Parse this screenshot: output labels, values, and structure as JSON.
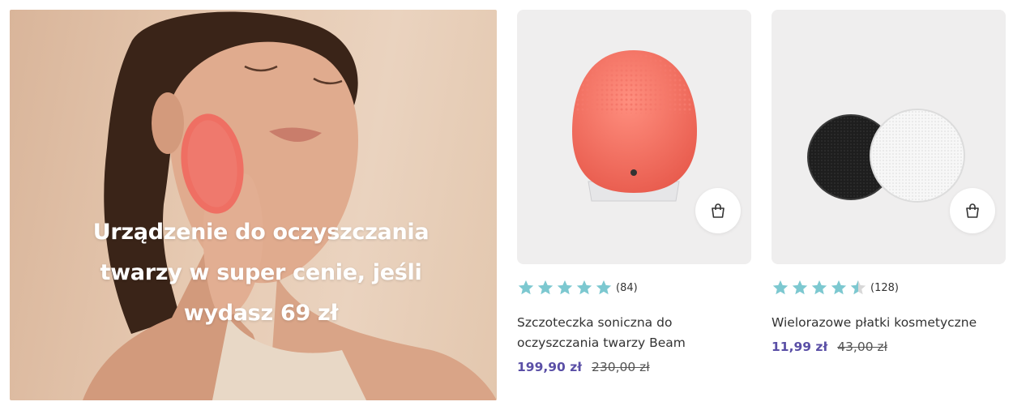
{
  "promo": {
    "headline": "Urządzenie do oczyszczania twarzy w super cenie, jeśli wydasz 69 zł",
    "image_icon": "woman-with-face-cleansing-device-photo"
  },
  "products": [
    {
      "name": "Szczoteczka soniczna do oczyszczania twarzy Beam",
      "rating": 5,
      "rating_count": "(84)",
      "price": "199,90 zł",
      "old_price": "230,00 zł",
      "image_icon": "coral-facial-cleansing-brush",
      "cart_icon": "shopping-bag-icon"
    },
    {
      "name": "Wielorazowe płatki kosmetyczne",
      "rating": 4.5,
      "rating_count": "(128)",
      "price": "11,99 zł",
      "old_price": "43,00 zł",
      "image_icon": "reusable-makeup-remover-pads",
      "cart_icon": "shopping-bag-icon"
    }
  ],
  "colors": {
    "star": "#7cc8d0",
    "star_empty": "#d8d8d8",
    "price": "#5a4fa6",
    "card_bg": "#efeeee"
  }
}
